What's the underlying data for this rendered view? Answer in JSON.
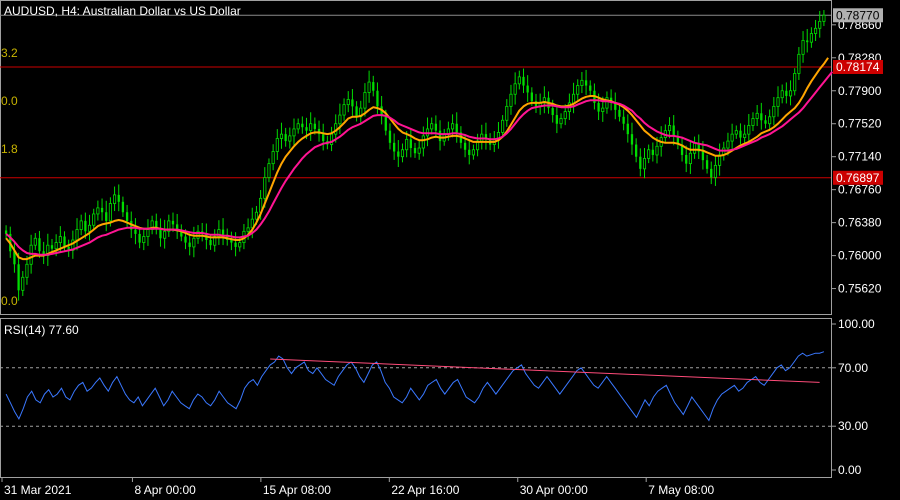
{
  "header": {
    "title": "AUDUSD, H4:  Australian Dollar vs US Dollar"
  },
  "rsi_label": "RSI(14) 77.60",
  "colors": {
    "background": "#000000",
    "bull_candle": "#00dd00",
    "bear_candle": "#00dd00",
    "ma_fast": "#ffa500",
    "ma_slow": "#ff1493",
    "hline": "#cc0000",
    "rsi_line": "#3a78ff",
    "trendline": "#ff4c7a",
    "fib_text": "#c8b400",
    "frame": "#a0a0a0",
    "current_price_badge_bg": "#b0b0b0",
    "hline_badge_bg": "#cc0000"
  },
  "chart_data": [
    {
      "type": "candlestick",
      "symbol": "AUDUSD",
      "timeframe": "H4",
      "title": "AUDUSD, H4:  Australian Dollar vs US Dollar",
      "ylim": [
        0.7535,
        0.789
      ],
      "y_ticks": [
        0.7866,
        0.7828,
        0.779,
        0.7752,
        0.7714,
        0.7676,
        0.7638,
        0.76,
        0.7562
      ],
      "y_tick_labels": [
        "0.78660",
        "0.78280",
        "0.77900",
        "0.77520",
        "0.77140",
        "0.76760",
        "0.76380",
        "0.76000",
        "0.75620"
      ],
      "x_tick_labels": [
        "31 Mar 2021",
        "8 Apr 00:00",
        "15 Apr 08:00",
        "22 Apr 16:00",
        "30 Apr 00:00",
        "7 May 08:00"
      ],
      "current_price": "0.78770",
      "horizontal_lines": [
        {
          "price": 0.78174,
          "label": "0.78174"
        },
        {
          "price": 0.76897,
          "label": "0.76897"
        }
      ],
      "fib_labels": [
        "3.2",
        "0.0",
        "1.8",
        "0.0"
      ],
      "closes": [
        0.7625,
        0.7605,
        0.759,
        0.756,
        0.7575,
        0.759,
        0.7612,
        0.762,
        0.7605,
        0.76,
        0.7612,
        0.7608,
        0.7615,
        0.7622,
        0.761,
        0.7606,
        0.7618,
        0.763,
        0.764,
        0.7628,
        0.7635,
        0.7648,
        0.7655,
        0.765,
        0.764,
        0.766,
        0.767,
        0.7662,
        0.765,
        0.764,
        0.763,
        0.7625,
        0.7615,
        0.7622,
        0.763,
        0.764,
        0.7632,
        0.762,
        0.7628,
        0.764,
        0.7636,
        0.763,
        0.7622,
        0.7615,
        0.761,
        0.762,
        0.7628,
        0.7625,
        0.7618,
        0.7612,
        0.7622,
        0.763,
        0.7624,
        0.7618,
        0.7615,
        0.761,
        0.7615,
        0.7628,
        0.7632,
        0.7642,
        0.765,
        0.7666,
        0.769,
        0.7706,
        0.772,
        0.7735,
        0.774,
        0.7732,
        0.7738,
        0.7746,
        0.7752,
        0.7748,
        0.7744,
        0.7752,
        0.7746,
        0.774,
        0.7732,
        0.7728,
        0.774,
        0.7752,
        0.7762,
        0.7774,
        0.778,
        0.7772,
        0.776,
        0.777,
        0.7788,
        0.78,
        0.779,
        0.7772,
        0.7762,
        0.7744,
        0.773,
        0.772,
        0.7714,
        0.7722,
        0.7734,
        0.7724,
        0.7718,
        0.7724,
        0.7738,
        0.7746,
        0.7752,
        0.7744,
        0.7732,
        0.774,
        0.7746,
        0.7752,
        0.7742,
        0.773,
        0.7722,
        0.7716,
        0.7722,
        0.7732,
        0.774,
        0.7734,
        0.7728,
        0.7734,
        0.7742,
        0.7756,
        0.7772,
        0.7786,
        0.7798,
        0.7806,
        0.7796,
        0.7788,
        0.7778,
        0.7772,
        0.7776,
        0.7782,
        0.777,
        0.7762,
        0.7752,
        0.7758,
        0.7766,
        0.7776,
        0.7786,
        0.7796,
        0.7802,
        0.7796,
        0.779,
        0.7776,
        0.7766,
        0.777,
        0.7782,
        0.7776,
        0.7768,
        0.776,
        0.7752,
        0.774,
        0.7728,
        0.7714,
        0.77,
        0.7712,
        0.7722,
        0.7716,
        0.7726,
        0.7736,
        0.7744,
        0.775,
        0.7738,
        0.7728,
        0.7716,
        0.7706,
        0.7718,
        0.773,
        0.772,
        0.771,
        0.77,
        0.769,
        0.7704,
        0.7716,
        0.7724,
        0.7732,
        0.774,
        0.7744,
        0.7736,
        0.774,
        0.775,
        0.7758,
        0.7764,
        0.7756,
        0.7752,
        0.776,
        0.7772,
        0.7782,
        0.779,
        0.7784,
        0.779,
        0.781,
        0.7832,
        0.7848,
        0.7846,
        0.7856,
        0.7862,
        0.787,
        0.7877
      ],
      "ma_fast_values": [
        0.762,
        0.7614,
        0.7606,
        0.7598,
        0.7596,
        0.7596,
        0.7598,
        0.76,
        0.76,
        0.76,
        0.7602,
        0.7604,
        0.7606,
        0.7608,
        0.761,
        0.7612,
        0.7614,
        0.7617,
        0.762,
        0.7623,
        0.7626,
        0.763,
        0.7634,
        0.7636,
        0.7637,
        0.7638,
        0.764,
        0.7641,
        0.764,
        0.7638,
        0.7636,
        0.7634,
        0.7632,
        0.7631,
        0.7631,
        0.7632,
        0.7632,
        0.7631,
        0.763,
        0.763,
        0.763,
        0.7629,
        0.7628,
        0.7626,
        0.7624,
        0.7623,
        0.7623,
        0.7623,
        0.7622,
        0.7621,
        0.7621,
        0.7621,
        0.7621,
        0.762,
        0.7619,
        0.7618,
        0.7618,
        0.762,
        0.7624,
        0.763,
        0.7638,
        0.7648,
        0.766,
        0.7672,
        0.7684,
        0.7696,
        0.7706,
        0.7714,
        0.772,
        0.7726,
        0.7731,
        0.7735,
        0.7738,
        0.7741,
        0.7742,
        0.7742,
        0.7741,
        0.774,
        0.7741,
        0.7744,
        0.7748,
        0.7753,
        0.7758,
        0.776,
        0.776,
        0.7761,
        0.7764,
        0.7768,
        0.7771,
        0.777,
        0.7768,
        0.7764,
        0.7758,
        0.7752,
        0.7746,
        0.7742,
        0.774,
        0.7738,
        0.7735,
        0.7733,
        0.7733,
        0.7734,
        0.7736,
        0.7737,
        0.7736,
        0.7736,
        0.7737,
        0.7738,
        0.7738,
        0.7737,
        0.7735,
        0.7733,
        0.7731,
        0.7731,
        0.7731,
        0.7731,
        0.7731,
        0.7731,
        0.7733,
        0.7737,
        0.7743,
        0.7751,
        0.7759,
        0.7767,
        0.7772,
        0.7775,
        0.7776,
        0.7776,
        0.7776,
        0.7777,
        0.7776,
        0.7775,
        0.7773,
        0.7772,
        0.7772,
        0.7773,
        0.7775,
        0.7778,
        0.7781,
        0.7783,
        0.7784,
        0.7784,
        0.7782,
        0.778,
        0.7779,
        0.7778,
        0.7776,
        0.7774,
        0.7771,
        0.7767,
        0.7762,
        0.7756,
        0.775,
        0.7744,
        0.774,
        0.7736,
        0.7733,
        0.7731,
        0.773,
        0.773,
        0.773,
        0.7729,
        0.7727,
        0.7724,
        0.7722,
        0.7722,
        0.7722,
        0.7721,
        0.7719,
        0.7717,
        0.7715,
        0.7715,
        0.7716,
        0.7718,
        0.7721,
        0.7724,
        0.7727,
        0.7729,
        0.7731,
        0.7734,
        0.7737,
        0.7741,
        0.7743,
        0.7745,
        0.7748,
        0.7752,
        0.7757,
        0.7762,
        0.7766,
        0.777,
        0.7776,
        0.7784,
        0.7793,
        0.7801,
        0.7808,
        0.7815,
        0.7821,
        0.7828
      ],
      "ma_slow_values": [
        0.7625,
        0.7621,
        0.7616,
        0.761,
        0.7606,
        0.7603,
        0.7602,
        0.7602,
        0.7601,
        0.7601,
        0.7601,
        0.7602,
        0.7603,
        0.7604,
        0.7605,
        0.7606,
        0.7607,
        0.7609,
        0.7611,
        0.7613,
        0.7615,
        0.7618,
        0.7621,
        0.7623,
        0.7624,
        0.7626,
        0.7628,
        0.763,
        0.7631,
        0.7632,
        0.7632,
        0.7632,
        0.7631,
        0.7631,
        0.7631,
        0.7631,
        0.7631,
        0.7631,
        0.763,
        0.763,
        0.763,
        0.763,
        0.7629,
        0.7628,
        0.7627,
        0.7626,
        0.7626,
        0.7626,
        0.7625,
        0.7624,
        0.7624,
        0.7624,
        0.7623,
        0.7623,
        0.7622,
        0.7621,
        0.7621,
        0.7622,
        0.7623,
        0.7626,
        0.763,
        0.7636,
        0.7643,
        0.7651,
        0.766,
        0.7669,
        0.7678,
        0.7686,
        0.7693,
        0.77,
        0.7706,
        0.7712,
        0.7717,
        0.7721,
        0.7725,
        0.7727,
        0.7729,
        0.773,
        0.7731,
        0.7734,
        0.7737,
        0.7741,
        0.7745,
        0.7748,
        0.775,
        0.7752,
        0.7755,
        0.7758,
        0.7761,
        0.7762,
        0.7762,
        0.7761,
        0.7759,
        0.7756,
        0.7752,
        0.775,
        0.7748,
        0.7746,
        0.7744,
        0.7742,
        0.7741,
        0.7741,
        0.7741,
        0.7741,
        0.774,
        0.774,
        0.774,
        0.7741,
        0.7741,
        0.774,
        0.7739,
        0.7737,
        0.7736,
        0.7735,
        0.7735,
        0.7735,
        0.7734,
        0.7734,
        0.7735,
        0.7737,
        0.7741,
        0.7746,
        0.7752,
        0.7758,
        0.7763,
        0.7767,
        0.777,
        0.7771,
        0.7772,
        0.7773,
        0.7773,
        0.7773,
        0.7772,
        0.7771,
        0.7771,
        0.7771,
        0.7772,
        0.7774,
        0.7776,
        0.7778,
        0.7779,
        0.7779,
        0.7779,
        0.7778,
        0.7778,
        0.7777,
        0.7776,
        0.7775,
        0.7773,
        0.777,
        0.7767,
        0.7762,
        0.7758,
        0.7753,
        0.7749,
        0.7746,
        0.7743,
        0.7741,
        0.7739,
        0.7738,
        0.7738,
        0.7737,
        0.7736,
        0.7734,
        0.7732,
        0.773,
        0.7729,
        0.7728,
        0.7727,
        0.7725,
        0.7723,
        0.7721,
        0.7721,
        0.7721,
        0.7722,
        0.7723,
        0.7725,
        0.7727,
        0.7729,
        0.7731,
        0.7733,
        0.7736,
        0.7738,
        0.774,
        0.7743,
        0.7746,
        0.7749,
        0.7753,
        0.7757,
        0.7761,
        0.7765,
        0.777,
        0.7776,
        0.7782,
        0.7788,
        0.7794,
        0.78,
        0.7806,
        0.7812
      ]
    },
    {
      "type": "line",
      "title": "RSI(14) 77.60",
      "ylim": [
        0,
        100
      ],
      "y_tick_labels": [
        "100.00",
        "70.00",
        "30.00",
        "0.00"
      ],
      "y_ticks": [
        100,
        70,
        30,
        0
      ],
      "levels": [
        70,
        30
      ],
      "current_value": 77.6,
      "values": [
        52,
        46,
        40,
        35,
        42,
        50,
        54,
        48,
        46,
        52,
        55,
        50,
        52,
        56,
        50,
        48,
        54,
        58,
        60,
        54,
        56,
        60,
        63,
        58,
        54,
        60,
        64,
        58,
        52,
        48,
        46,
        50,
        44,
        48,
        52,
        56,
        50,
        44,
        48,
        54,
        50,
        46,
        44,
        42,
        48,
        52,
        50,
        46,
        44,
        48,
        54,
        50,
        46,
        44,
        42,
        48,
        56,
        60,
        62,
        58,
        64,
        68,
        72,
        74,
        78,
        76,
        70,
        66,
        70,
        72,
        74,
        68,
        66,
        70,
        66,
        62,
        60,
        58,
        64,
        68,
        72,
        74,
        70,
        64,
        60,
        66,
        72,
        74,
        68,
        60,
        56,
        50,
        48,
        46,
        50,
        56,
        52,
        48,
        52,
        58,
        60,
        62,
        56,
        52,
        56,
        60,
        62,
        56,
        50,
        48,
        46,
        50,
        56,
        60,
        56,
        52,
        56,
        60,
        64,
        68,
        70,
        72,
        66,
        62,
        58,
        56,
        60,
        64,
        60,
        56,
        52,
        56,
        60,
        64,
        68,
        70,
        66,
        62,
        58,
        56,
        60,
        64,
        60,
        56,
        52,
        48,
        44,
        40,
        36,
        42,
        48,
        44,
        50,
        54,
        56,
        58,
        52,
        46,
        42,
        38,
        44,
        50,
        46,
        42,
        38,
        34,
        42,
        48,
        52,
        54,
        56,
        58,
        54,
        56,
        60,
        62,
        64,
        60,
        58,
        62,
        66,
        70,
        72,
        68,
        70,
        74,
        78,
        80,
        78,
        79,
        80,
        80,
        81
      ],
      "trendlines": [
        {
          "from": 76,
          "to": 60,
          "series": "resistance"
        }
      ]
    }
  ]
}
